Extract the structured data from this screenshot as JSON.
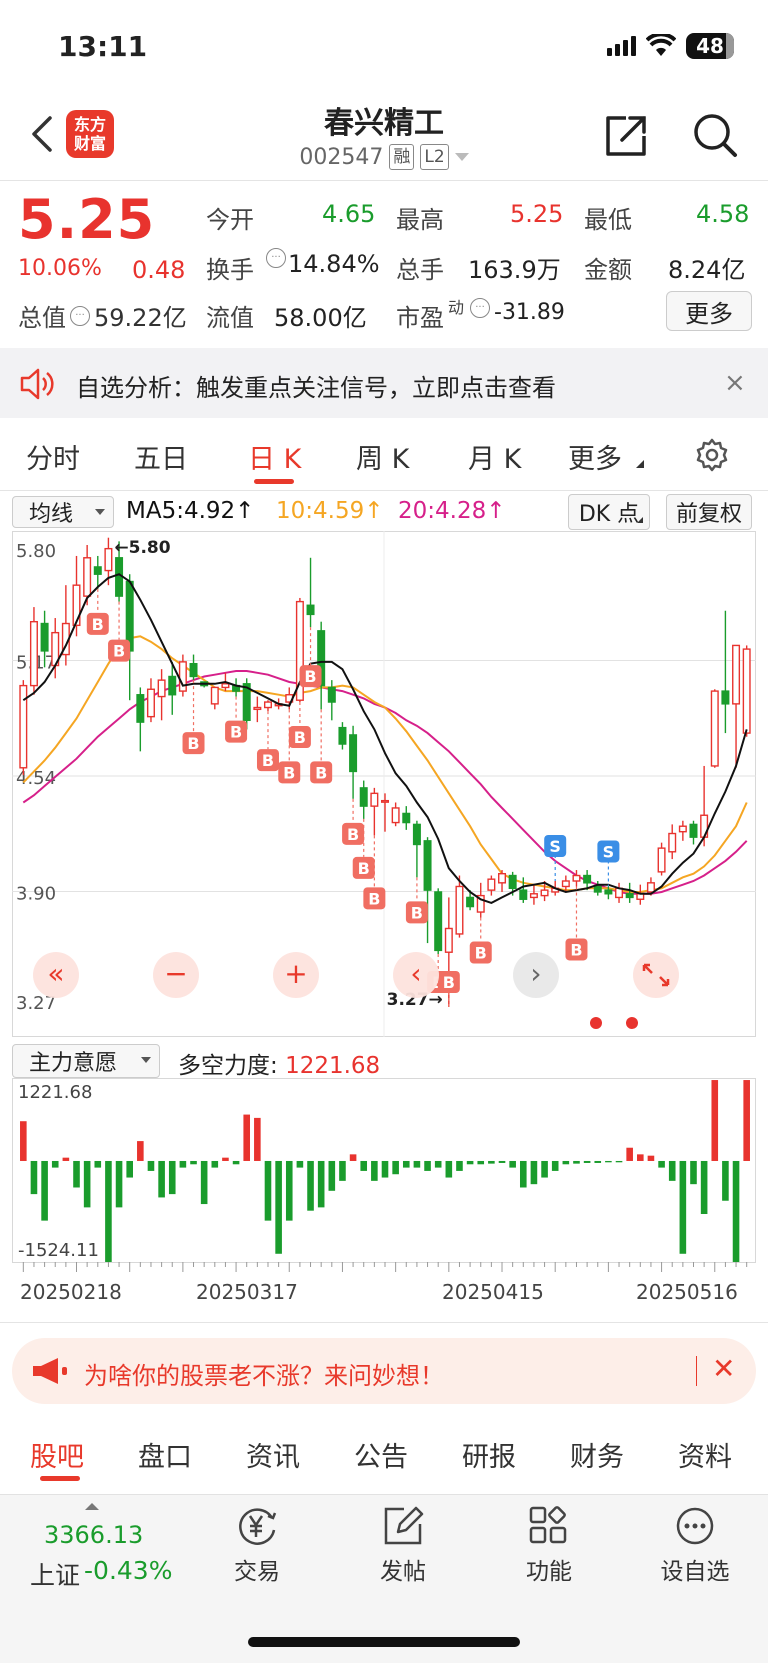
{
  "status": {
    "time": "13:11",
    "battery": "48"
  },
  "header": {
    "app_logo_line1": "东方",
    "app_logo_line2": "财富",
    "stock_name": "春兴精工",
    "stock_code": "002547",
    "tag_margin": "融",
    "tag_level": "L2"
  },
  "quote": {
    "price": "5.25",
    "pct_change": "10.06%",
    "amt_change": "0.48",
    "total_value_label": "总值",
    "total_value": "59.22亿",
    "open_label": "今开",
    "open": "4.65",
    "high_label": "最高",
    "high": "5.25",
    "low_label": "最低",
    "low": "4.58",
    "turnover_label": "换手",
    "turnover": "14.84%",
    "volume_label": "总手",
    "volume": "163.9万",
    "amount_label": "金额",
    "amount": "8.24亿",
    "float_label": "流值",
    "float_value": "58.00亿",
    "pe_label": "市盈",
    "pe_sup": "动",
    "pe": "-31.89",
    "more_label": "更多"
  },
  "notice": {
    "text": "自选分析：触发重点关注信号，立即点击查看",
    "close": "×"
  },
  "kline_tabs": [
    {
      "label": "分时"
    },
    {
      "label": "五日"
    },
    {
      "label": "日 K"
    },
    {
      "label": "周 K"
    },
    {
      "label": "月 K"
    },
    {
      "label": "更多"
    }
  ],
  "ma_legend": {
    "selector": "均线",
    "ma5": "MA5:4.92↑",
    "ma10": "10:4.59↑",
    "ma20": "20:4.28↑",
    "dk_label": "DK 点",
    "fq_label": "前复权"
  },
  "colors": {
    "up": "#e8332e",
    "down": "#1a9c2c",
    "ma5": "#111111",
    "ma10": "#f5a623",
    "ma20": "#d6208a",
    "accent": "#e8392b"
  },
  "chart_data": [
    {
      "type": "candlestick",
      "y_ticks": [
        "5.80",
        "5.17",
        "4.54",
        "3.90",
        "3.27"
      ],
      "ylim": [
        3.27,
        5.8
      ],
      "max_label": "←5.80",
      "min_label": "3.27→",
      "candles": [
        [
          4.58,
          5.03,
          5.06,
          4.54
        ],
        [
          5.03,
          5.38,
          5.46,
          4.98
        ],
        [
          5.37,
          5.22,
          5.44,
          5.13
        ],
        [
          5.14,
          5.32,
          5.4,
          5.07
        ],
        [
          5.2,
          5.37,
          5.58,
          5.14
        ],
        [
          5.36,
          5.58,
          5.74,
          5.3
        ],
        [
          5.52,
          5.73,
          5.8,
          5.47
        ],
        [
          5.68,
          5.64,
          5.74,
          5.56
        ],
        [
          5.66,
          5.78,
          5.84,
          5.58
        ],
        [
          5.73,
          5.52,
          5.82,
          5.49
        ],
        [
          5.6,
          5.22,
          5.64,
          4.95
        ],
        [
          4.98,
          4.83,
          5.02,
          4.67
        ],
        [
          4.86,
          5.01,
          5.07,
          4.83
        ],
        [
          4.97,
          5.06,
          5.12,
          4.84
        ],
        [
          5.08,
          4.98,
          5.16,
          4.87
        ],
        [
          5.0,
          5.16,
          5.2,
          4.97
        ],
        [
          5.15,
          5.08,
          5.2,
          5.06
        ],
        [
          5.05,
          5.03,
          5.05,
          5.02
        ],
        [
          4.93,
          5.02,
          5.02,
          4.9
        ],
        [
          5.02,
          5.04,
          5.1,
          5.0
        ],
        [
          5.03,
          5.0,
          5.07,
          4.97
        ],
        [
          5.04,
          4.84,
          5.07,
          4.79
        ],
        [
          4.9,
          4.91,
          4.97,
          4.83
        ],
        [
          4.91,
          4.94,
          4.95,
          4.89
        ],
        [
          4.92,
          4.93,
          4.96,
          4.9
        ],
        [
          4.94,
          4.98,
          5.02,
          4.9
        ],
        [
          4.95,
          5.49,
          5.51,
          4.94
        ],
        [
          5.47,
          5.42,
          5.73,
          5.35
        ],
        [
          5.33,
          5.03,
          5.38,
          4.9
        ],
        [
          5.02,
          4.94,
          5.06,
          4.84
        ],
        [
          4.8,
          4.71,
          4.83,
          4.68
        ],
        [
          4.76,
          4.56,
          4.81,
          4.41
        ],
        [
          4.47,
          4.37,
          4.51,
          4.3
        ],
        [
          4.37,
          4.44,
          4.47,
          4.21
        ],
        [
          4.4,
          4.4,
          4.44,
          4.23
        ],
        [
          4.28,
          4.36,
          4.39,
          4.26
        ],
        [
          4.33,
          4.28,
          4.37,
          4.24
        ],
        [
          4.27,
          4.16,
          4.29,
          3.98
        ],
        [
          4.18,
          3.91,
          4.2,
          3.62
        ],
        [
          3.9,
          3.58,
          3.92,
          3.56
        ],
        [
          3.57,
          3.7,
          3.87,
          3.27
        ],
        [
          3.67,
          3.93,
          3.99,
          3.65
        ],
        [
          3.87,
          3.82,
          3.91,
          3.8
        ],
        [
          3.79,
          3.88,
          3.95,
          3.76
        ],
        [
          3.91,
          3.97,
          3.99,
          3.88
        ],
        [
          3.95,
          4.0,
          4.02,
          3.9
        ],
        [
          3.99,
          3.92,
          4.01,
          3.88
        ],
        [
          3.91,
          3.86,
          3.98,
          3.84
        ],
        [
          3.87,
          3.89,
          3.94,
          3.83
        ],
        [
          3.88,
          3.91,
          3.96,
          3.85
        ],
        [
          3.9,
          3.92,
          3.96,
          3.88
        ],
        [
          3.93,
          3.96,
          3.99,
          3.9
        ],
        [
          3.96,
          3.99,
          4.02,
          3.93
        ],
        [
          3.99,
          3.95,
          4.02,
          3.91
        ],
        [
          3.93,
          3.9,
          3.96,
          3.88
        ],
        [
          3.91,
          3.89,
          3.93,
          3.86
        ],
        [
          3.87,
          3.92,
          3.95,
          3.84
        ],
        [
          3.89,
          3.87,
          3.95,
          3.84
        ],
        [
          3.86,
          3.89,
          3.94,
          3.83
        ],
        [
          3.9,
          3.95,
          3.98,
          3.88
        ],
        [
          4.01,
          4.14,
          4.17,
          3.99
        ],
        [
          4.12,
          4.22,
          4.27,
          4.08
        ],
        [
          4.23,
          4.26,
          4.29,
          4.18
        ],
        [
          4.27,
          4.2,
          4.29,
          4.16
        ],
        [
          4.2,
          4.32,
          4.59,
          4.15
        ],
        [
          4.59,
          5.0,
          5.01,
          4.58
        ],
        [
          5.0,
          4.93,
          5.44,
          4.77
        ],
        [
          4.93,
          5.25,
          5.25,
          4.58
        ],
        [
          4.77,
          5.23,
          5.25,
          4.75
        ]
      ],
      "ma5": [
        4.95,
        4.99,
        5.05,
        5.14,
        5.25,
        5.38,
        5.51,
        5.57,
        5.62,
        5.64,
        5.6,
        5.5,
        5.39,
        5.27,
        5.15,
        5.03,
        5.04,
        5.04,
        5.04,
        5.05,
        5.03,
        5.02,
        4.99,
        4.96,
        4.93,
        4.92,
        5.05,
        5.15,
        5.16,
        5.16,
        5.12,
        5.01,
        4.89,
        4.79,
        4.66,
        4.55,
        4.48,
        4.39,
        4.31,
        4.19,
        4.03,
        3.96,
        3.9,
        3.86,
        3.84,
        3.87,
        3.9,
        3.93,
        3.94,
        3.95,
        3.92,
        3.9,
        3.91,
        3.92,
        3.94,
        3.94,
        3.92,
        3.91,
        3.89,
        3.89,
        3.93,
        4.0,
        4.06,
        4.11,
        4.2,
        4.33,
        4.45,
        4.59,
        4.79
      ],
      "ma10": [
        4.5,
        4.56,
        4.62,
        4.69,
        4.77,
        4.85,
        4.95,
        5.05,
        5.15,
        5.24,
        5.29,
        5.3,
        5.27,
        5.23,
        5.18,
        5.14,
        5.1,
        5.06,
        5.02,
        5.0,
        5.0,
        5.0,
        5.0,
        4.99,
        4.98,
        4.97,
        4.99,
        5.0,
        5.02,
        5.02,
        5.03,
        5.02,
        4.98,
        4.94,
        4.91,
        4.85,
        4.78,
        4.7,
        4.62,
        4.53,
        4.44,
        4.35,
        4.26,
        4.16,
        4.08,
        4.0,
        3.97,
        3.95,
        3.94,
        3.93,
        3.92,
        3.91,
        3.91,
        3.92,
        3.92,
        3.92,
        3.91,
        3.9,
        3.9,
        3.91,
        3.92,
        3.95,
        3.98,
        4.0,
        4.04,
        4.1,
        4.18,
        4.26,
        4.39
      ],
      "ma20": [
        4.39,
        4.43,
        4.48,
        4.53,
        4.58,
        4.63,
        4.69,
        4.75,
        4.8,
        4.85,
        4.9,
        4.94,
        4.97,
        5.0,
        5.02,
        5.04,
        5.06,
        5.08,
        5.09,
        5.1,
        5.11,
        5.11,
        5.1,
        5.09,
        5.07,
        5.05,
        5.04,
        5.03,
        5.02,
        5.01,
        5.0,
        4.98,
        4.96,
        4.93,
        4.91,
        4.88,
        4.84,
        4.81,
        4.77,
        4.72,
        4.67,
        4.61,
        4.55,
        4.49,
        4.42,
        4.36,
        4.3,
        4.24,
        4.18,
        4.12,
        4.07,
        4.03,
        3.99,
        3.96,
        3.94,
        3.92,
        3.9,
        3.89,
        3.89,
        3.89,
        3.9,
        3.92,
        3.94,
        3.96,
        3.99,
        4.03,
        4.07,
        4.12,
        4.18
      ],
      "signals": [
        {
          "i": 7,
          "t": "B"
        },
        {
          "i": 9,
          "t": "B"
        },
        {
          "i": 16,
          "t": "B"
        },
        {
          "i": 20,
          "t": "B"
        },
        {
          "i": 23,
          "t": "B"
        },
        {
          "i": 25,
          "t": "B"
        },
        {
          "i": 26,
          "t": "B"
        },
        {
          "i": 27,
          "t": "B"
        },
        {
          "i": 28,
          "t": "B"
        },
        {
          "i": 31,
          "t": "B"
        },
        {
          "i": 32,
          "t": "B"
        },
        {
          "i": 33,
          "t": "B"
        },
        {
          "i": 37,
          "t": "B"
        },
        {
          "i": 39,
          "t": "B"
        },
        {
          "i": 40,
          "t": "B"
        },
        {
          "i": 43,
          "t": "B"
        },
        {
          "i": 50,
          "t": "S"
        },
        {
          "i": 52,
          "t": "B"
        },
        {
          "i": 55,
          "t": "S"
        }
      ]
    },
    {
      "type": "bar",
      "title": "多空力度",
      "value": "1221.68",
      "ylim": [
        -1524.11,
        1221.68
      ],
      "y_ticks": [
        "1221.68",
        "-1524.11"
      ],
      "x_ticks": [
        "20250218",
        "20250317",
        "20250415",
        "20250516"
      ],
      "values": [
        600,
        -500,
        -900,
        -100,
        50,
        -400,
        -700,
        -100,
        -1524,
        -700,
        -250,
        300,
        -150,
        -550,
        -500,
        -100,
        -50,
        -650,
        -100,
        50,
        -50,
        700,
        650,
        -900,
        -1400,
        -900,
        -100,
        -750,
        -700,
        -450,
        -300,
        100,
        -150,
        -300,
        -250,
        -200,
        -100,
        -100,
        -150,
        -100,
        -250,
        -150,
        -50,
        -50,
        -40,
        -30,
        -100,
        -400,
        -350,
        -250,
        -150,
        -50,
        -40,
        -30,
        -30,
        -20,
        -20,
        200,
        100,
        80,
        -100,
        -300,
        -1400,
        -350,
        -800,
        1221,
        -600,
        -1524,
        1221
      ]
    },
    {
      "chart_controls": [
        "«",
        "−",
        "+",
        "‹",
        "›"
      ]
    }
  ],
  "indicator": {
    "selector": "主力意愿",
    "label": "多空力度: ",
    "value": "1221.68"
  },
  "ad": {
    "text": "为啥你的股票老不涨？来问妙想！",
    "close": "✕"
  },
  "bottom_tabs": [
    {
      "label": "股吧"
    },
    {
      "label": "盘口"
    },
    {
      "label": "资讯"
    },
    {
      "label": "公告"
    },
    {
      "label": "研报"
    },
    {
      "label": "财务"
    },
    {
      "label": "资料"
    }
  ],
  "footer": {
    "index_value": "3366.13",
    "index_name": "上证",
    "index_change": "-0.43%",
    "buttons": [
      {
        "label": "交易",
        "icon": "yen-exchange-icon"
      },
      {
        "label": "发帖",
        "icon": "edit-icon"
      },
      {
        "label": "功能",
        "icon": "grid-icon"
      },
      {
        "label": "设自选",
        "icon": "more-dots-icon"
      }
    ]
  }
}
